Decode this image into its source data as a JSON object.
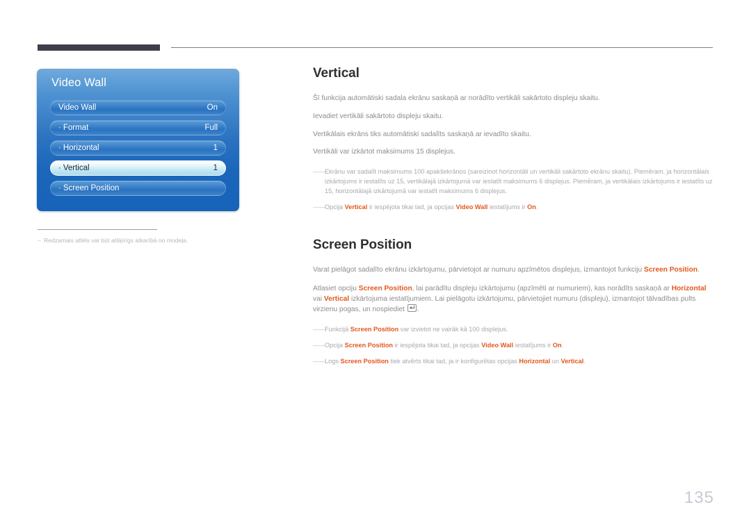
{
  "page": {
    "number": "135"
  },
  "osd": {
    "title": "Video Wall",
    "rows": [
      {
        "bullet": "",
        "label": "Video Wall",
        "value": "On",
        "selected": false
      },
      {
        "bullet": "·",
        "label": "Format",
        "value": "Full",
        "selected": false
      },
      {
        "bullet": "·",
        "label": "Horizontal",
        "value": "1",
        "selected": false
      },
      {
        "bullet": "·",
        "label": "Vertical",
        "value": "1",
        "selected": true
      },
      {
        "bullet": "·",
        "label": "Screen Position",
        "value": "",
        "selected": false
      }
    ]
  },
  "left_note": {
    "dash": "–",
    "text": "Redzamais attēls var būt atšķirīgs atkarībā no modeļa."
  },
  "sections": [
    {
      "title": "Vertical",
      "paragraphs": [
        "Šī funkcija automātiski sadala ekrānu saskaņā ar norādīto vertikāli sakārtoto displeju skaitu.",
        "Ievadiet vertikāli sakārtoto displeju skaitu.",
        "Vertikālais ekrāns tiks automātiski sadalīts saskaņā ar ievadīto skaitu.",
        "Vertikāli var izkārtot maksimums 15 displejus."
      ],
      "notes": [
        {
          "dash": "――",
          "parts": [
            {
              "t": "Ekrānu var sadalīt maksimums 100 apakšekrānos (sareizinot horizontāli un vertikāli sakārtoto ekrānu skaitu). Piemēram, ja horizontālais izkārtojums ir iestatīts uz 15, vertikālajā izkārtojumā var iestatīt maksimums 6 displejus. Piemēram, ja vertikālais izkārtojums ir iestatīts uz 15, horizontālajā izkārtojumā var iestatīt maksimums 6 displejus."
            }
          ]
        },
        {
          "dash": "――",
          "parts": [
            {
              "t": "Opcija "
            },
            {
              "t": "Vertical",
              "hl": true
            },
            {
              "t": " ir iespējota tikai tad, ja opcijas "
            },
            {
              "t": "Video Wall",
              "hl": true
            },
            {
              "t": " iestatījums ir "
            },
            {
              "t": "On",
              "hl": true
            },
            {
              "t": "."
            }
          ]
        }
      ]
    },
    {
      "title": "Screen Position",
      "paragraphs_rich": [
        [
          {
            "t": "Varat pielāgot sadalīto ekrānu izkārtojumu, pārvietojot ar numuru apzīmētos displejus, izmantojot funkciju "
          },
          {
            "t": "Screen Position",
            "hl": true
          },
          {
            "t": "."
          }
        ],
        [
          {
            "t": "Atlasiet opciju "
          },
          {
            "t": "Screen Position",
            "hl": true
          },
          {
            "t": ", lai parādītu displeju izkārtojumu (apzīmēti ar numuriem), kas norādīts saskaņā ar "
          },
          {
            "t": "Horizontal",
            "hl": true
          },
          {
            "t": " vai "
          },
          {
            "t": "Vertical",
            "hl": true
          },
          {
            "t": " izkārtojuma iestatījumiem. Lai pielāgotu izkārtojumu, pārvietojiet numuru (displeju), izmantojot tālvadības pults virzienu pogas, un nospiediet "
          },
          {
            "icon": "enter-key-icon"
          },
          {
            "t": "."
          }
        ]
      ],
      "notes": [
        {
          "dash": "――",
          "parts": [
            {
              "t": "Funkcijā "
            },
            {
              "t": "Screen Position",
              "hl": true
            },
            {
              "t": " var izvietot ne vairāk kā 100 displejus."
            }
          ]
        },
        {
          "dash": "――",
          "parts": [
            {
              "t": "Opcija "
            },
            {
              "t": "Screen Position",
              "hl": true
            },
            {
              "t": " ir iespējota tikai tad, ja opcijas "
            },
            {
              "t": "Video Wall",
              "hl": true
            },
            {
              "t": " iestatījums ir "
            },
            {
              "t": "On",
              "hl": true
            },
            {
              "t": "."
            }
          ]
        },
        {
          "dash": "――",
          "parts": [
            {
              "t": "Logs "
            },
            {
              "t": "Screen Position",
              "hl": true
            },
            {
              "t": " tiek atvērts tikai tad, ja ir konfigurētas opcijas "
            },
            {
              "t": "Horizontal",
              "hl": true
            },
            {
              "t": " un "
            },
            {
              "t": "Vertical",
              "hl": true
            },
            {
              "t": "."
            }
          ]
        }
      ]
    }
  ],
  "colors": {
    "highlight": "#e2581f",
    "panel_blue": "#1763b9",
    "rule_dark": "#413e4c",
    "page_number": "#c9c9d4"
  }
}
